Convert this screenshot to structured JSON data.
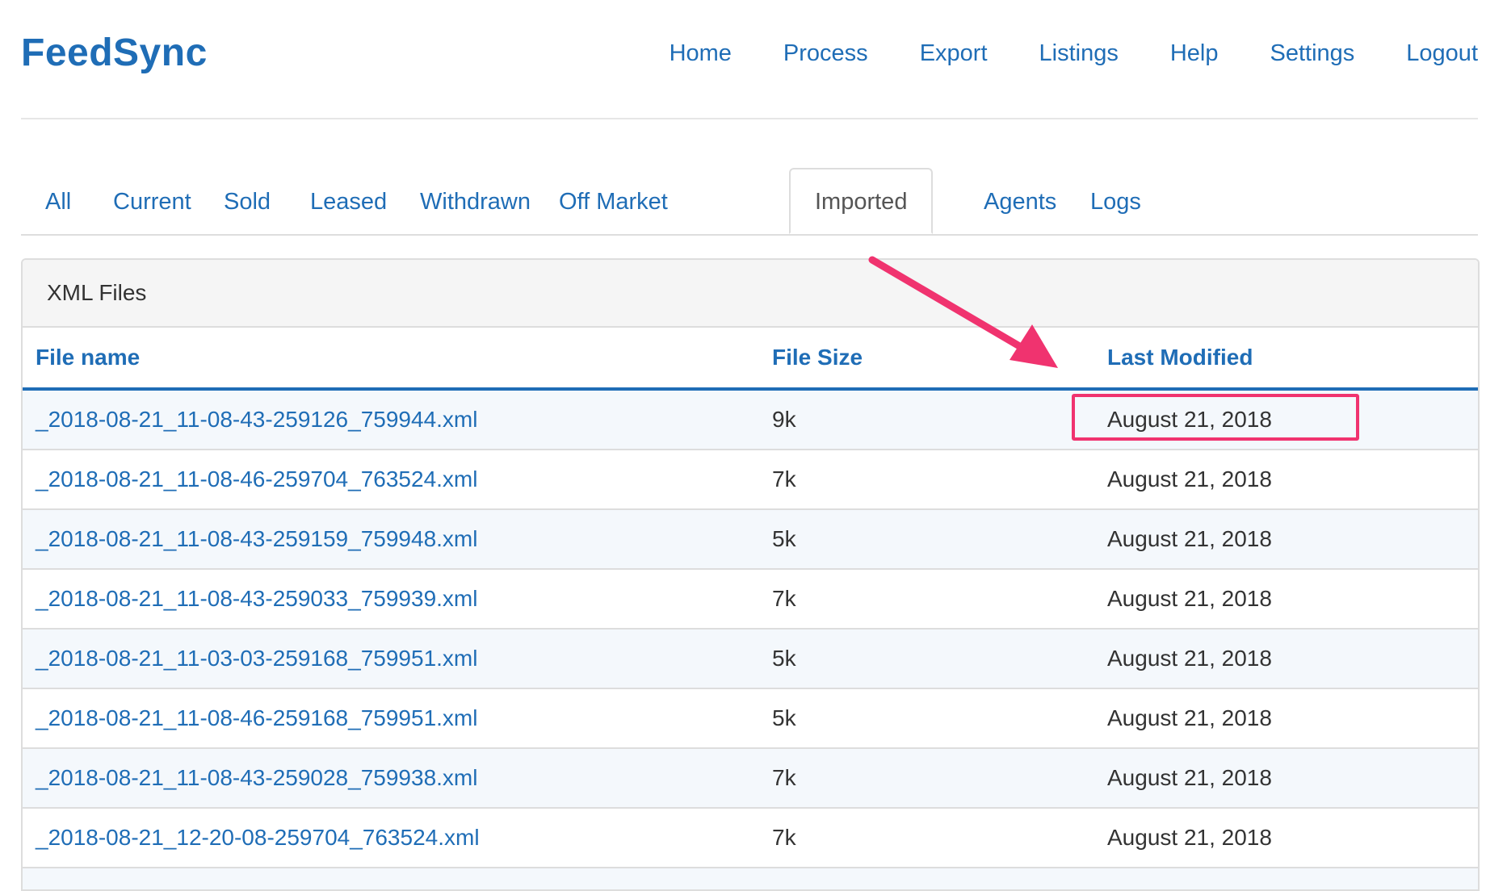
{
  "header": {
    "brand": "FeedSync",
    "nav": [
      "Home",
      "Process",
      "Export",
      "Listings",
      "Help",
      "Settings",
      "Logout"
    ]
  },
  "tabs": [
    "All",
    "Current",
    "Sold",
    "Leased",
    "Withdrawn",
    "Off Market",
    "Imported",
    "Agents",
    "Logs"
  ],
  "active_tab": "Imported",
  "panel": {
    "title": "XML Files",
    "columns": [
      "File name",
      "File Size",
      "Last Modified"
    ],
    "rows": [
      {
        "file": "_2018-08-21_11-08-43-259126_759944.xml",
        "size": "9k",
        "modified": "August 21, 2018"
      },
      {
        "file": "_2018-08-21_11-08-46-259704_763524.xml",
        "size": "7k",
        "modified": "August 21, 2018"
      },
      {
        "file": "_2018-08-21_11-08-43-259159_759948.xml",
        "size": "5k",
        "modified": "August 21, 2018"
      },
      {
        "file": "_2018-08-21_11-08-43-259033_759939.xml",
        "size": "7k",
        "modified": "August 21, 2018"
      },
      {
        "file": "_2018-08-21_11-03-03-259168_759951.xml",
        "size": "5k",
        "modified": "August 21, 2018"
      },
      {
        "file": "_2018-08-21_11-08-46-259168_759951.xml",
        "size": "5k",
        "modified": "August 21, 2018"
      },
      {
        "file": "_2018-08-21_11-08-43-259028_759938.xml",
        "size": "7k",
        "modified": "August 21, 2018"
      },
      {
        "file": "_2018-08-21_12-20-08-259704_763524.xml",
        "size": "7k",
        "modified": "August 21, 2018"
      }
    ]
  },
  "colors": {
    "link": "#1f6db6",
    "annotation": "#f0336f"
  }
}
